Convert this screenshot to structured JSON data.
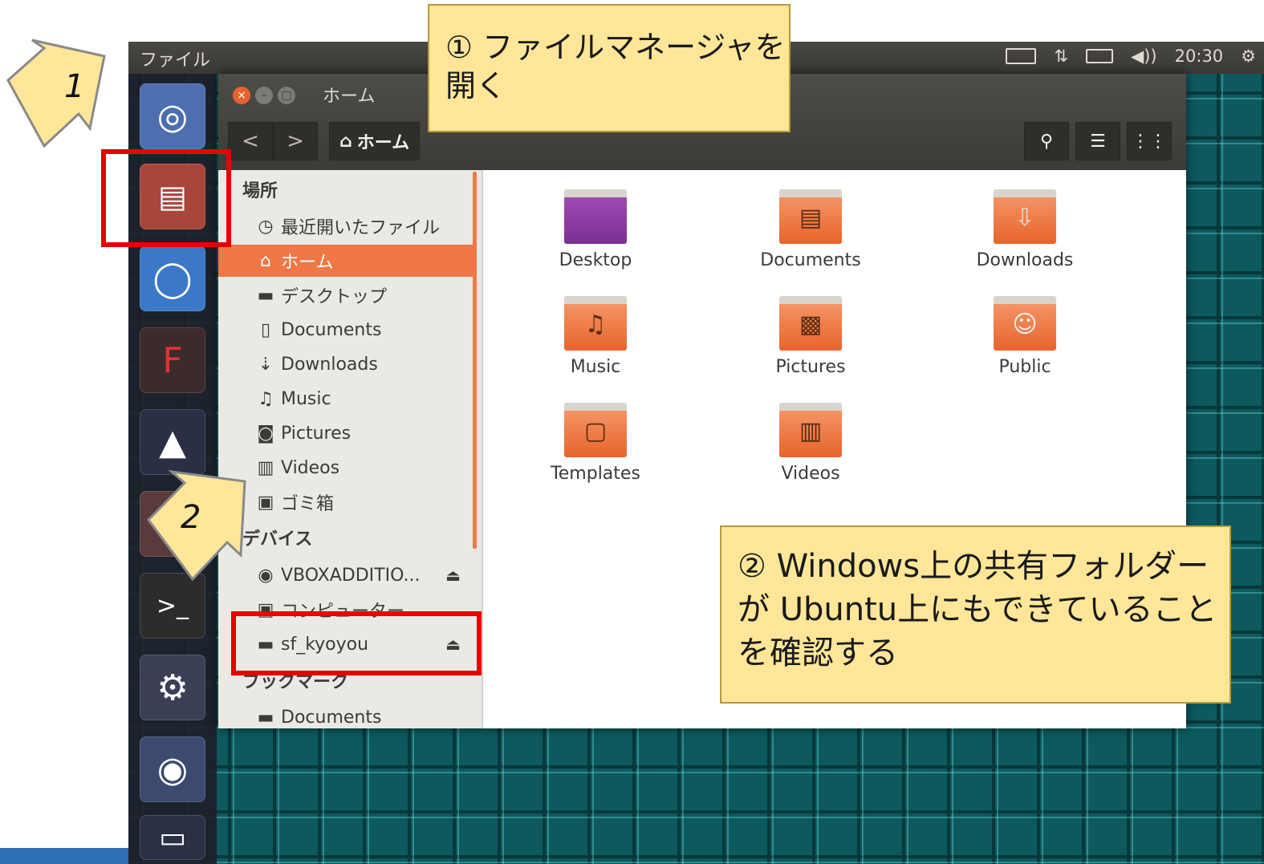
{
  "top_panel": {
    "app_title": "ファイル",
    "time": "20:30",
    "icons": [
      "keyboard-icon",
      "network-icon",
      "battery-icon",
      "volume-icon",
      "settings-gear-icon"
    ]
  },
  "launcher": {
    "items": [
      "ubuntu-dash-icon",
      "files-icon",
      "chromium-icon",
      "filezilla-icon",
      "inkscape-icon",
      "app-icon",
      "terminal-icon",
      "system-settings-icon",
      "dvd-icon",
      "trash-icon"
    ]
  },
  "window": {
    "title": "ホーム",
    "path_button": "ホーム",
    "nav_back": "<",
    "nav_forward": ">"
  },
  "sidebar": {
    "places_heading": "場所",
    "places": [
      {
        "icon": "clock-icon",
        "label": "最近開いたファイル"
      },
      {
        "icon": "home-icon",
        "label": "ホーム"
      },
      {
        "icon": "folder-icon",
        "label": "デスクトップ"
      },
      {
        "icon": "document-icon",
        "label": "Documents"
      },
      {
        "icon": "download-icon",
        "label": "Downloads"
      },
      {
        "icon": "music-icon",
        "label": "Music"
      },
      {
        "icon": "camera-icon",
        "label": "Pictures"
      },
      {
        "icon": "film-icon",
        "label": "Videos"
      },
      {
        "icon": "trash-icon",
        "label": "ゴミ箱"
      }
    ],
    "devices_heading": "デバイス",
    "devices": [
      {
        "icon": "disc-icon",
        "label": "VBOXADDITIO...",
        "eject": "⏏"
      },
      {
        "icon": "computer-icon",
        "label": "コンピューター"
      },
      {
        "icon": "drive-icon",
        "label": "sf_kyoyou",
        "eject": "⏏"
      }
    ],
    "bookmarks_heading": "ブックマーク",
    "bookmarks": [
      {
        "icon": "folder-icon",
        "label": "Documents"
      }
    ]
  },
  "files": [
    {
      "name": "Desktop",
      "icon": "desktop-folder-icon"
    },
    {
      "name": "Documents",
      "icon": "documents-folder-icon"
    },
    {
      "name": "Downloads",
      "icon": "downloads-folder-icon"
    },
    {
      "name": "Music",
      "icon": "music-folder-icon"
    },
    {
      "name": "Pictures",
      "icon": "pictures-folder-icon"
    },
    {
      "name": "Public",
      "icon": "public-folder-icon"
    },
    {
      "name": "Templates",
      "icon": "templates-folder-icon"
    },
    {
      "name": "Videos",
      "icon": "videos-folder-icon"
    }
  ],
  "annotations": {
    "callout1": "① ファイルマネージャを開く",
    "callout2": "② Windows上の共有フォルダーが Ubuntu上にもできていることを確認する",
    "step1": "1",
    "step2": "2"
  },
  "colors": {
    "accent": "#f07746",
    "callout_bg": "#ffe699",
    "highlight": "#e80000"
  }
}
